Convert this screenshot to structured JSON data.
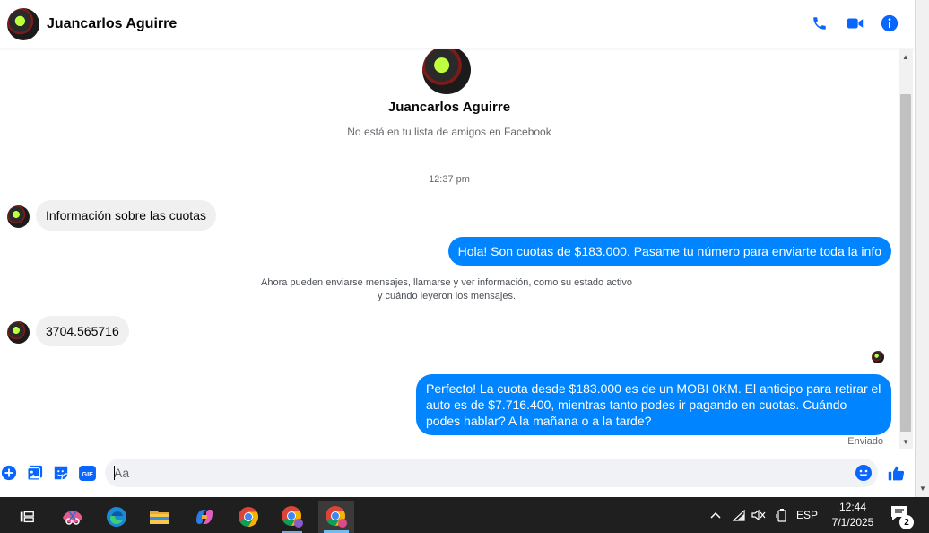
{
  "header": {
    "contact_name": "Juancarlos Aguirre",
    "icons": [
      "phone-icon",
      "video-camera-icon",
      "info-icon"
    ],
    "accent_color": "#0866ff"
  },
  "profile": {
    "name": "Juancarlos Aguirre",
    "subtitle": "No está en tu lista de amigos en Facebook"
  },
  "chat": {
    "timestamp": "12:37 pm",
    "messages": [
      {
        "direction": "incoming",
        "text": "Información sobre las cuotas"
      },
      {
        "direction": "outgoing",
        "text": "Hola! Son cuotas de $183.000. Pasame tu número para enviarte toda la info"
      },
      {
        "direction": "incoming",
        "text": "3704.565716"
      },
      {
        "direction": "outgoing",
        "text": "Perfecto! La cuota desde $183.000 es de un MOBI 0KM. El anticipo para retirar el auto es de $7.716.400, mientras tanto podes ir pagando en cuotas. Cuándo podes hablar? A la mañana o a la tarde?"
      }
    ],
    "system_note": "Ahora pueden enviarse mensajes, llamarse y ver información, como su estado activo\ny cuándo leyeron los mensajes.",
    "sent_status": "Enviado",
    "outgoing_color": "#0084ff",
    "incoming_color": "#f0f0f0"
  },
  "composer": {
    "placeholder": "Aa",
    "left_icons": [
      "plus-icon",
      "image-icon",
      "sticker-icon",
      "gif-icon"
    ],
    "gif_label": "GIF",
    "right_icons": [
      "emoji-icon",
      "thumbs-up-icon"
    ]
  },
  "taskbar": {
    "apps": [
      "task-view-icon",
      "snipping-tool-icon",
      "edge-icon",
      "file-explorer-icon",
      "copilot-icon",
      "chrome-icon",
      "chrome-profile-icon",
      "chrome-profile-active-icon"
    ],
    "tray": {
      "language": "ESP",
      "time": "12:44",
      "date": "7/1/2025",
      "notification_count": "2"
    }
  }
}
